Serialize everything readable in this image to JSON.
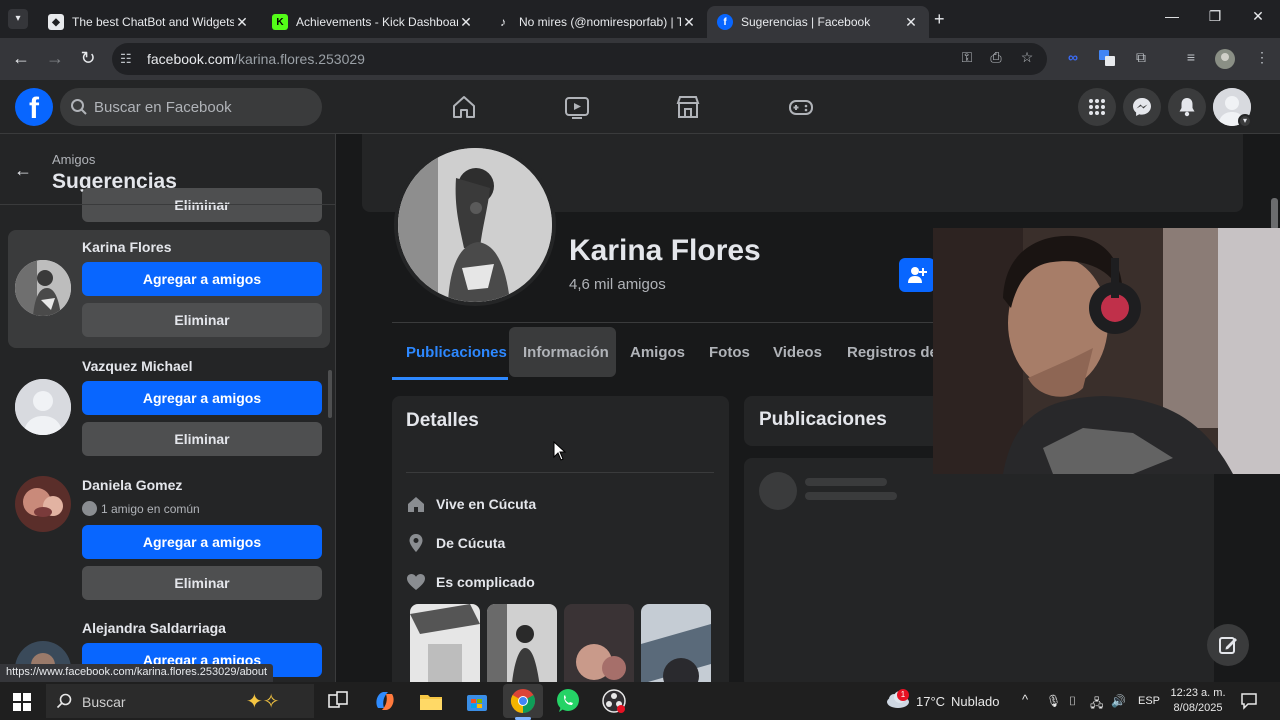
{
  "browser": {
    "tabs": [
      {
        "title": "The best ChatBot and Widgets"
      },
      {
        "title": "Achievements - Kick Dashboard"
      },
      {
        "title": "No mires (@nomiresporfab) | Ti"
      },
      {
        "title": "Sugerencias | Facebook",
        "active": true
      }
    ],
    "url_domain": "facebook.com",
    "url_path": "/karina.flores.253029"
  },
  "fb_header": {
    "search_placeholder": "Buscar en Facebook"
  },
  "sidebar": {
    "breadcrumb": "Amigos",
    "title": "Sugerencias",
    "add_label": "Agregar a amigos",
    "remove_label": "Eliminar",
    "partial_remove_label": "Eliminar",
    "suggestions": [
      {
        "name": "Karina Flores",
        "mutual": ""
      },
      {
        "name": "Vazquez Michael",
        "mutual": ""
      },
      {
        "name": "Daniela Gomez",
        "mutual": "1 amigo en común"
      },
      {
        "name": "Alejandra Saldarriaga",
        "mutual": ""
      }
    ]
  },
  "profile": {
    "name": "Karina Flores",
    "friends": "4,6 mil amigos",
    "tabs": [
      "Publicaciones",
      "Información",
      "Amigos",
      "Fotos",
      "Videos",
      "Registros de v"
    ],
    "active_tab": "Publicaciones",
    "details": {
      "title": "Detalles",
      "lives_in": "Vive en Cúcuta",
      "from": "De Cúcuta",
      "relationship": "Es complicado"
    },
    "posts_title": "Publicaciones"
  },
  "status_bar_url": "https://www.facebook.com/karina.flores.253029/about",
  "taskbar": {
    "search_placeholder": "Buscar",
    "weather_temp": "17°C",
    "weather_text": "Nublado",
    "weather_badge": "1",
    "lang": "ESP",
    "time": "12:23 a. m.",
    "date": "8/08/2025"
  },
  "colors": {
    "fb_blue": "#0866ff",
    "link_blue": "#2d88ff",
    "bg": "#18191a",
    "card": "#242526"
  }
}
